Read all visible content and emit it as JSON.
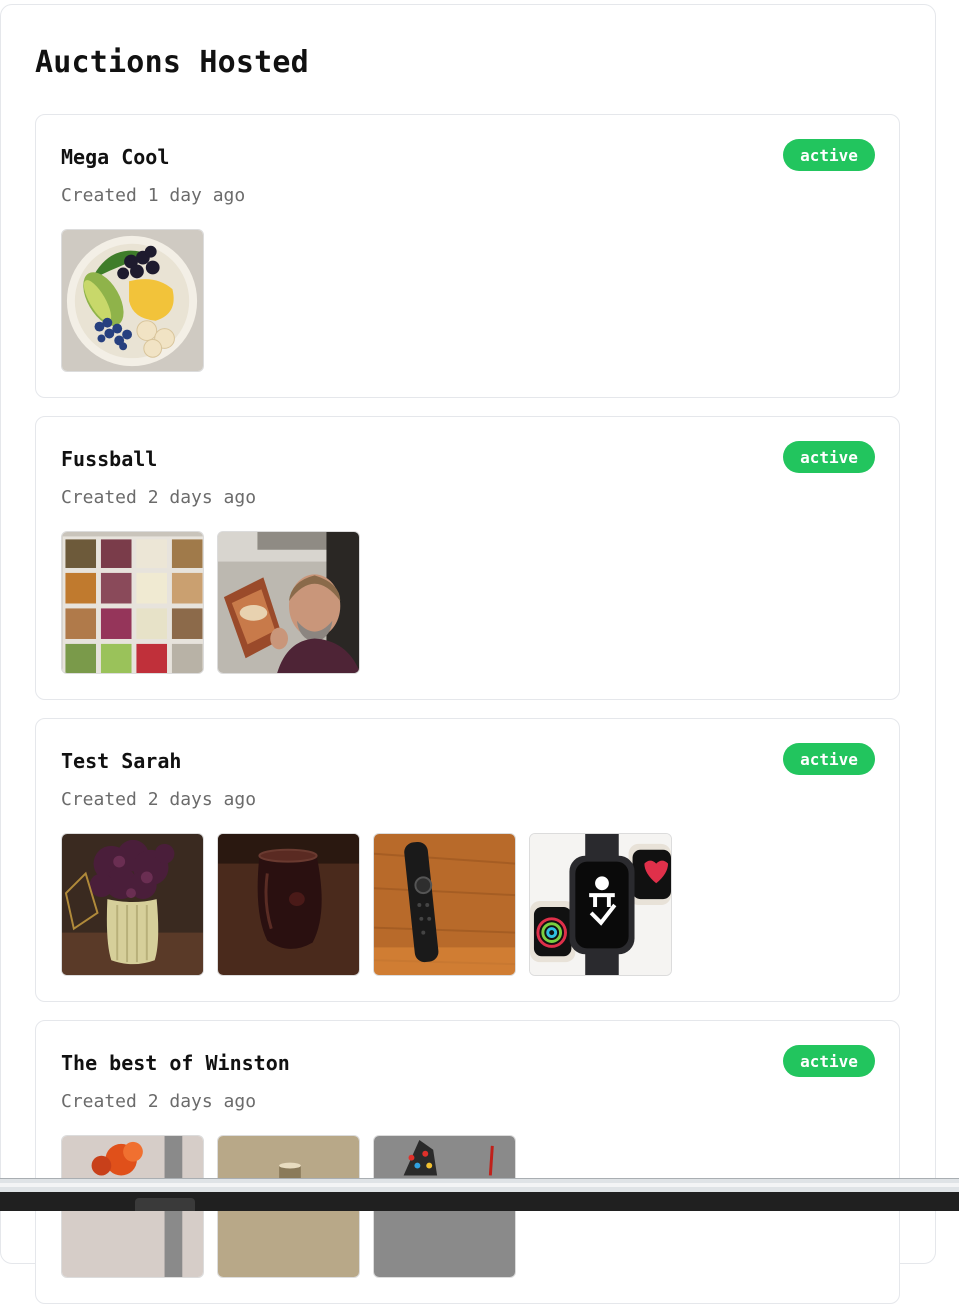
{
  "page": {
    "title": "Auctions Hosted"
  },
  "auctions": [
    {
      "title": "Mega Cool",
      "created": "Created 1 day ago",
      "status": "active",
      "images": [
        "salad-bowl-image"
      ]
    },
    {
      "title": "Fussball",
      "created": "Created 2 days ago",
      "status": "active",
      "images": [
        "buffet-trays-image",
        "man-holding-snack-bag-image"
      ]
    },
    {
      "title": "Test Sarah",
      "created": "Created 2 days ago",
      "status": "active",
      "images": [
        "flower-vase-image",
        "dark-glass-image",
        "remote-control-image",
        "smartwatches-image"
      ]
    },
    {
      "title": "The best of Winston",
      "created": "Created 2 days ago",
      "status": "active",
      "images": [
        "orange-balloon-dog-image",
        "candle-image",
        "colorful-sculpture-image"
      ]
    }
  ],
  "colors": {
    "status_active": "#22c55e",
    "border": "#e5e7eb",
    "meta_text": "#6b6b6b"
  }
}
